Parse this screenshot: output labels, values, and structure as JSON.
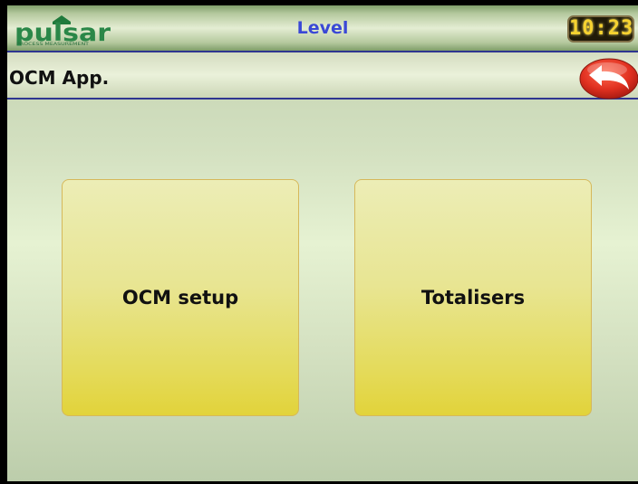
{
  "header": {
    "logo_text": "pulsar",
    "logo_tagline": "PROCESS MEASUREMENT",
    "title": "Level",
    "clock": "10:23"
  },
  "subheader": {
    "title": "OCM App.",
    "back_icon": "back-arrow-icon"
  },
  "tiles": [
    {
      "label": "OCM setup"
    },
    {
      "label": "Totalisers"
    }
  ],
  "colors": {
    "title_text": "#3a48d6",
    "divider": "#2e3590",
    "back_button": "#e03020",
    "clock_digits": "#f6d230",
    "tile_bottom": "#e2d33a"
  }
}
